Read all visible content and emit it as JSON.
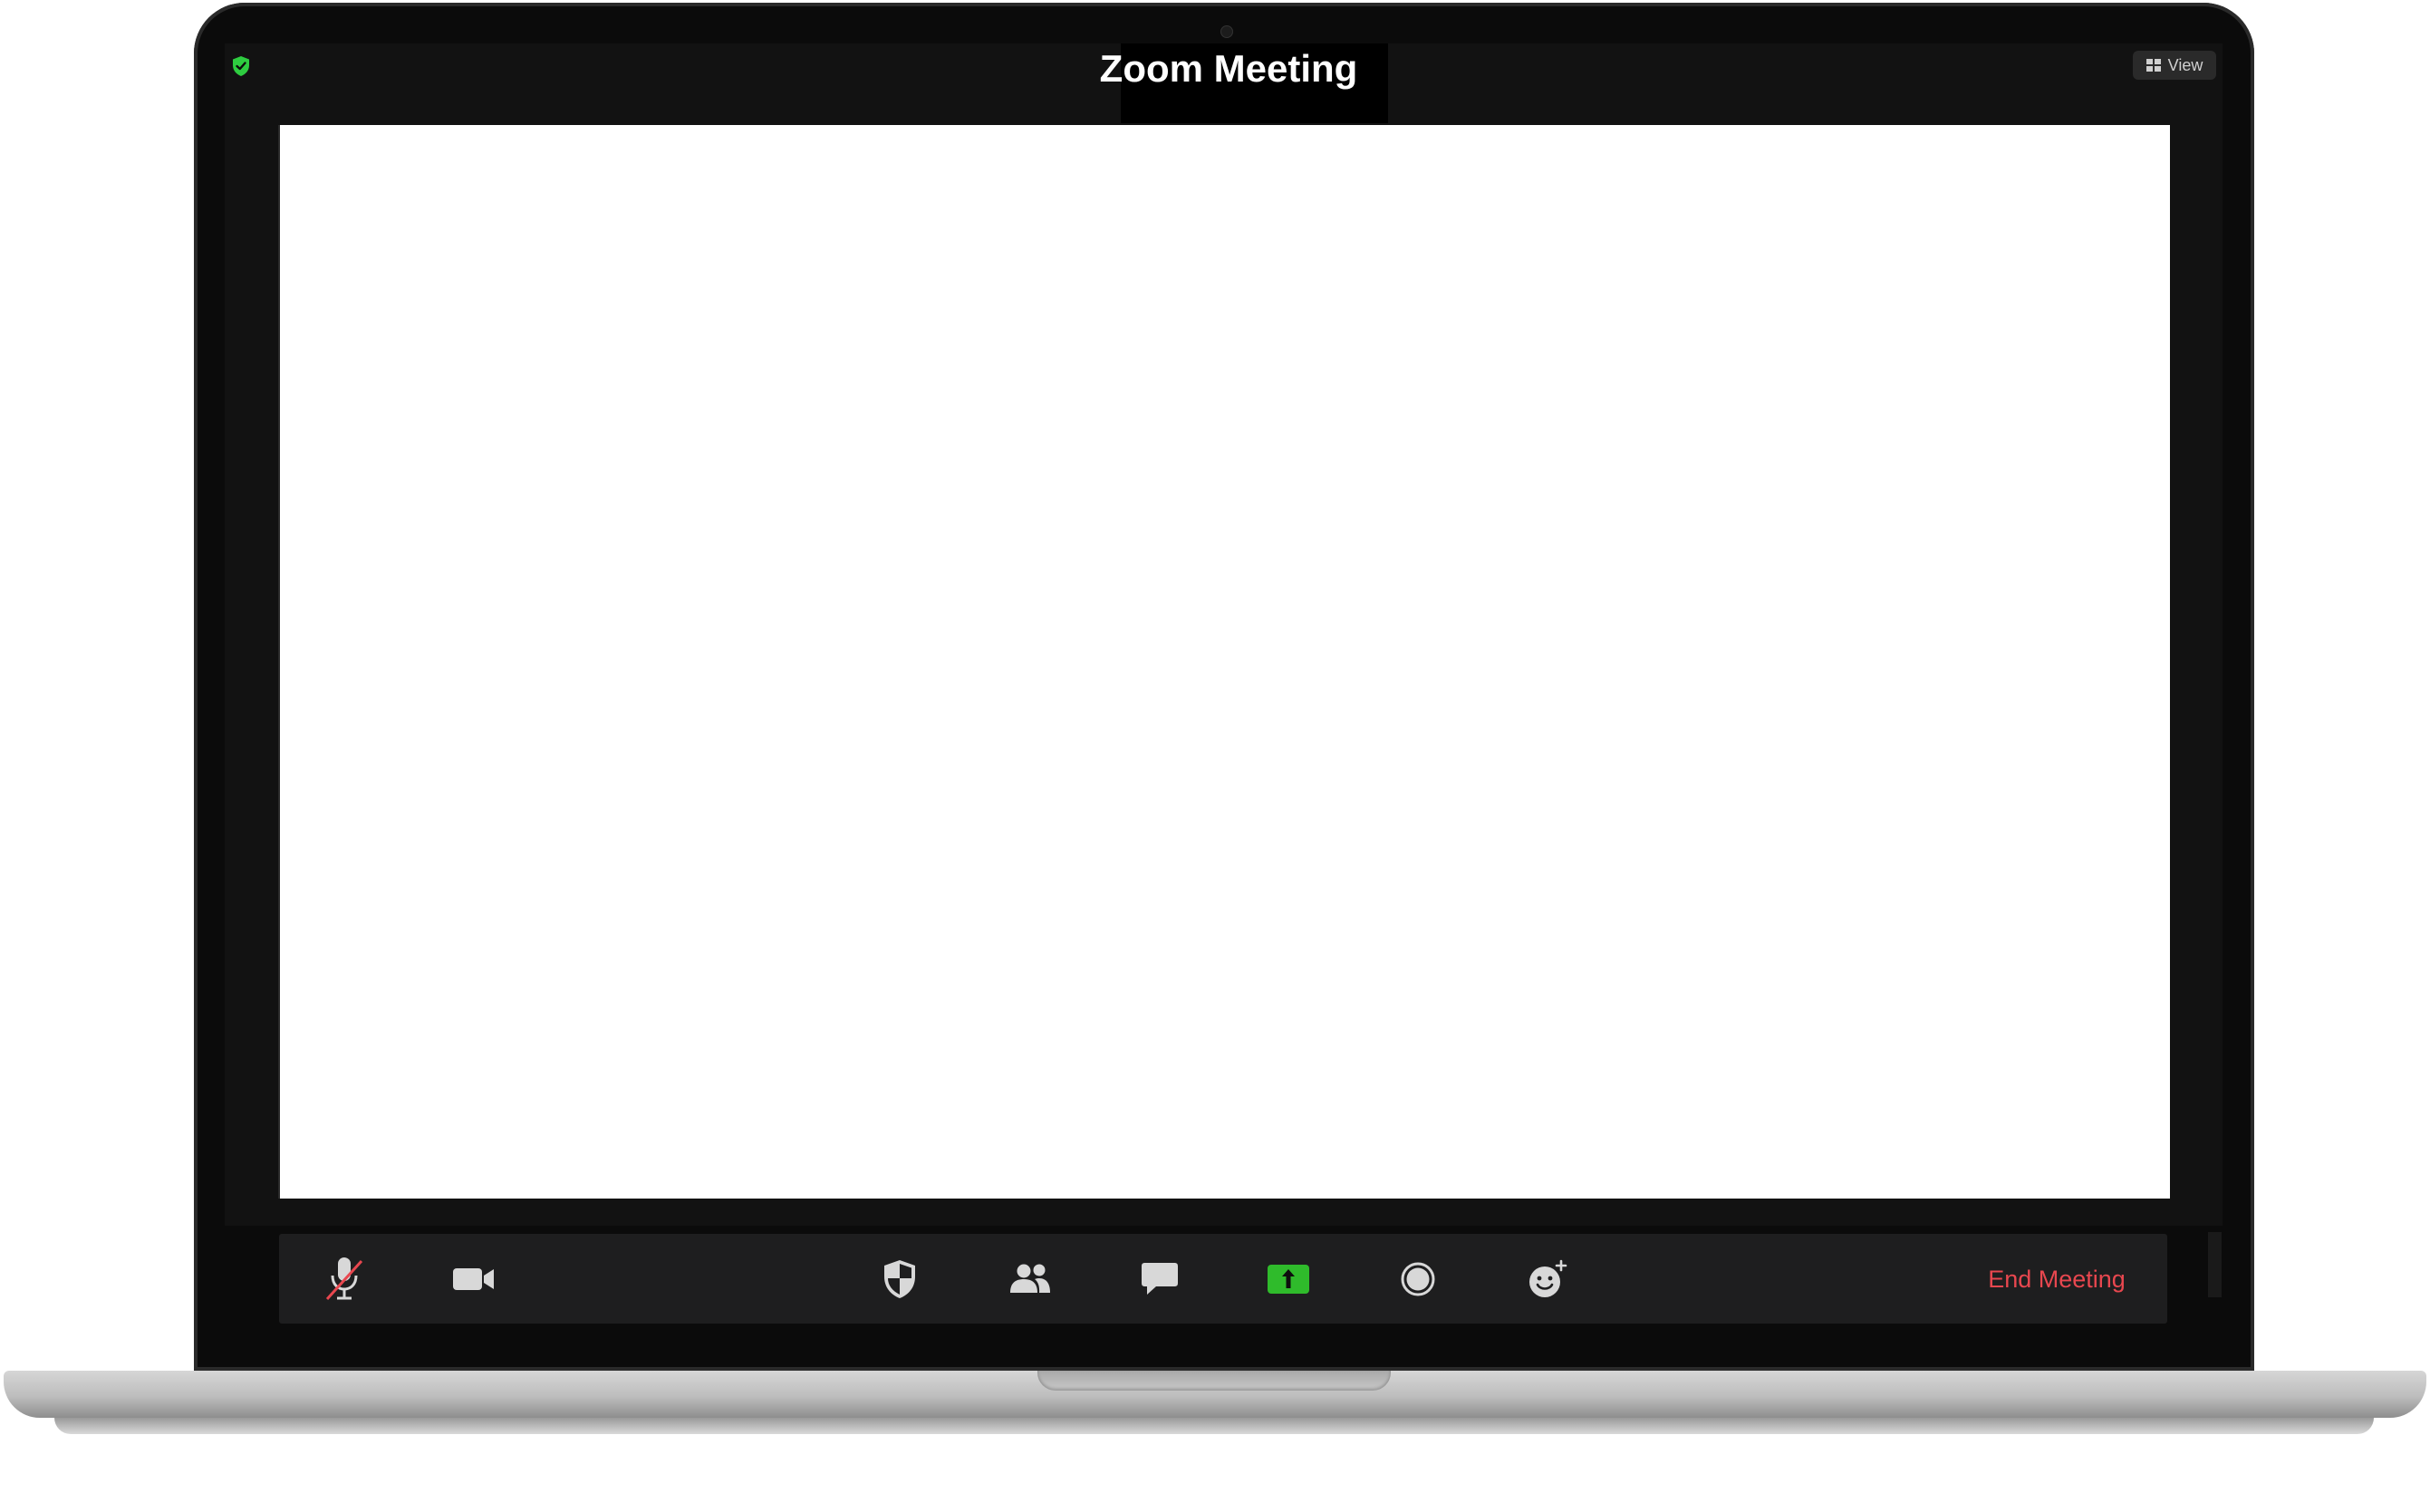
{
  "window": {
    "title": "Zoom Meeting",
    "view_label": "View"
  },
  "toolbar": {
    "items": [
      {
        "name": "mute-button",
        "icon": "microphone-muted-icon"
      },
      {
        "name": "video-button",
        "icon": "video-camera-icon"
      },
      {
        "name": "security-button",
        "icon": "shield-icon"
      },
      {
        "name": "participants-button",
        "icon": "people-icon"
      },
      {
        "name": "chat-button",
        "icon": "chat-bubble-icon"
      },
      {
        "name": "share-screen-button",
        "icon": "share-arrow-icon"
      },
      {
        "name": "record-button",
        "icon": "record-icon"
      },
      {
        "name": "reactions-button",
        "icon": "smiley-plus-icon"
      }
    ],
    "end_label": "End Meeting"
  },
  "colors": {
    "end_meeting": "#e8474f",
    "share_green": "#2fbb2b",
    "encryption_green": "#2ecc40",
    "toolbar_bg": "#1e1e1f"
  }
}
